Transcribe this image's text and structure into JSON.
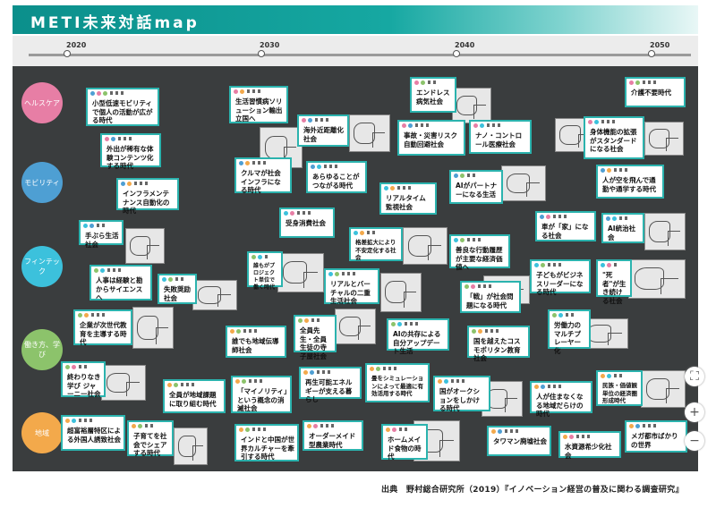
{
  "header": {
    "title": "METI未来対話map"
  },
  "timeline": {
    "years": [
      "2020",
      "2030",
      "2040",
      "2050"
    ]
  },
  "categories": [
    {
      "label": "ヘルスケア",
      "color": "#e77ea5"
    },
    {
      "label": "モビリティ",
      "color": "#4e9fd3"
    },
    {
      "label": "フィンテック",
      "color": "#3cc1dc"
    },
    {
      "label": "働き方、学び",
      "color": "#8cc36b"
    },
    {
      "label": "地域",
      "color": "#f3a94b"
    }
  ],
  "cards": [
    {
      "text": "小型低速モビリティで個人の活動が広がる時代"
    },
    {
      "text": "外出が稀有な体験コンテンツ化する時代"
    },
    {
      "text": "インフラメンテナンス自動化の時代"
    },
    {
      "text": "手ぶら生活社会"
    },
    {
      "text": "人事は経験と勘からサイエンスへ"
    },
    {
      "text": "失敗奨励社会"
    },
    {
      "text": "企業が次世代教育を主導する時代"
    },
    {
      "text": "終わりなき学び ジャーニー社会"
    },
    {
      "text": "超富裕層特区による外国人誘致社会"
    },
    {
      "text": "子育てを社会でシェアする時代"
    },
    {
      "text": "全員が地域課題に取り組む時代"
    },
    {
      "text": "生活習慣病ソリューション輸出立国へ"
    },
    {
      "text": "クルマが社会インフラになる時代"
    },
    {
      "text": "受身消費社会"
    },
    {
      "text": "誰もがプロジェクト単位で働く時代"
    },
    {
      "text": "誰でも地域伝導師社会"
    },
    {
      "text": "「マイノリティ」という概念の消滅社会"
    },
    {
      "text": "インドと中国が世界カルチャーを牽引する時代"
    },
    {
      "text": "海外近距離化社会"
    },
    {
      "text": "あらゆることがつながる時代"
    },
    {
      "text": "格差拡大により不安定化する社会"
    },
    {
      "text": "リアルとバーチャルの二重生活社会"
    },
    {
      "text": "全員先生・全員生徒の寺子屋社会"
    },
    {
      "text": "再生可能エネルギーが支える暮らし"
    },
    {
      "text": "オーダーメイド型農業時代"
    },
    {
      "text": "エンドレス病気社会"
    },
    {
      "text": "事故・災害リスク自動回避社会"
    },
    {
      "text": "リアルタイム監視社会"
    },
    {
      "text": "AIの共存による自分アップデート生活"
    },
    {
      "text": "畳をシミュレーションによって最適に有効活用する時代"
    },
    {
      "text": "ホームメイド食物の時代"
    },
    {
      "text": "ナノ・コントロール医療社会"
    },
    {
      "text": "AIがパートナーになる生活"
    },
    {
      "text": "善良な行動履歴が主要な経済価値へ"
    },
    {
      "text": "「戦」が社会問題になる時代"
    },
    {
      "text": "国を越えたコスモポリタン教育社会"
    },
    {
      "text": "国がオークションをしかける時代"
    },
    {
      "text": "タワマン廃墟社会"
    },
    {
      "text": "車が「家」になる社会"
    },
    {
      "text": "子どもがビジネスリーダーになる時代"
    },
    {
      "text": "労働力のマルチプレーヤー化"
    },
    {
      "text": "人が住まなくなる地域だらけの時代"
    },
    {
      "text": "水資源希少化社会"
    },
    {
      "text": "介護不要時代"
    },
    {
      "text": "身体機能の拡張がスタンダードになる社会"
    },
    {
      "text": "人が空を飛んで通勤や通学する時代"
    },
    {
      "text": "AI統治社会"
    },
    {
      "text": "\"死者\"が生き続ける社会"
    },
    {
      "text": "民族・価値観単位の経済圏形成時代"
    },
    {
      "text": "メガ都市ばかりの世界"
    }
  ],
  "controls": {
    "expand_icon": "⛶",
    "zoom_in": "+",
    "zoom_out": "−"
  },
  "source": "出典　野村総合研究所（2019）『イノベーション経営の普及に関わる調査研究』"
}
